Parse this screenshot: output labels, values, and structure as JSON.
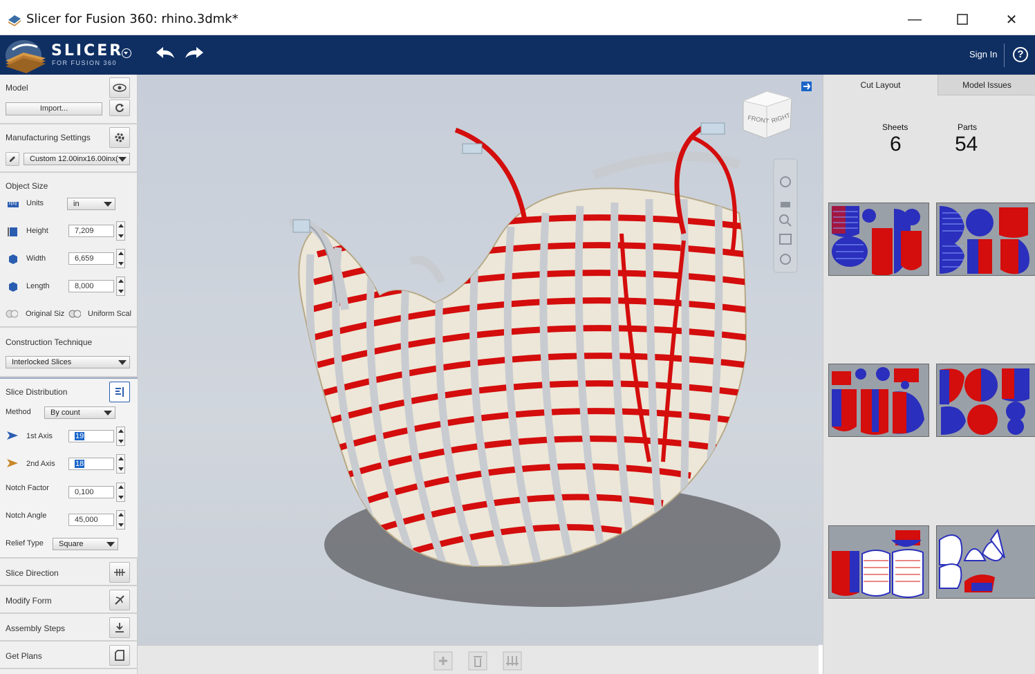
{
  "window": {
    "title": "Slicer for Fusion 360: rhino.3dmk*",
    "minimize": "—",
    "maximize": "☐",
    "close": "✕"
  },
  "header": {
    "logo_text": "SLICER",
    "logo_sub": "FOR FUSION 360",
    "sign_in": "Sign In",
    "help": "?"
  },
  "model": {
    "title": "Model",
    "import_label": "Import..."
  },
  "manufacturing": {
    "title": "Manufacturing Settings",
    "preset": "Custom 12.00inx16.00inx("
  },
  "object_size": {
    "title": "Object Size",
    "units_label": "Units",
    "units_value": "in",
    "height_label": "Height",
    "height_value": "7,209",
    "width_label": "Width",
    "width_value": "6,659",
    "length_label": "Length",
    "length_value": "8,000",
    "original_size": "Original Siz",
    "uniform_scale": "Uniform Scal"
  },
  "construction": {
    "title": "Construction Technique",
    "value": "Interlocked Slices"
  },
  "slice_distribution": {
    "title": "Slice Distribution",
    "method_label": "Method",
    "method_value": "By count",
    "axis1_label": "1st Axis",
    "axis1_value": "19",
    "axis2_label": "2nd Axis",
    "axis2_value": "18",
    "notch_factor_label": "Notch Factor",
    "notch_factor_value": "0,100",
    "notch_angle_label": "Notch Angle",
    "notch_angle_value": "45,000",
    "relief_label": "Relief Type",
    "relief_value": "Square"
  },
  "steps": {
    "slice_direction": "Slice Direction",
    "modify_form": "Modify Form",
    "assembly_steps": "Assembly Steps",
    "get_plans": "Get Plans"
  },
  "viewcube": {
    "front": "FRONT",
    "right": "RIGHT"
  },
  "right_panel": {
    "tab_cut_layout": "Cut Layout",
    "tab_model_issues": "Model Issues",
    "sheets_label": "Sheets",
    "sheets_value": "6",
    "parts_label": "Parts",
    "parts_value": "54"
  },
  "colors": {
    "header_bg": "#0f2f63",
    "slice_red": "#d40d0d",
    "slice_grey": "#c8ccd1",
    "part_blue": "#2a2fbd"
  }
}
